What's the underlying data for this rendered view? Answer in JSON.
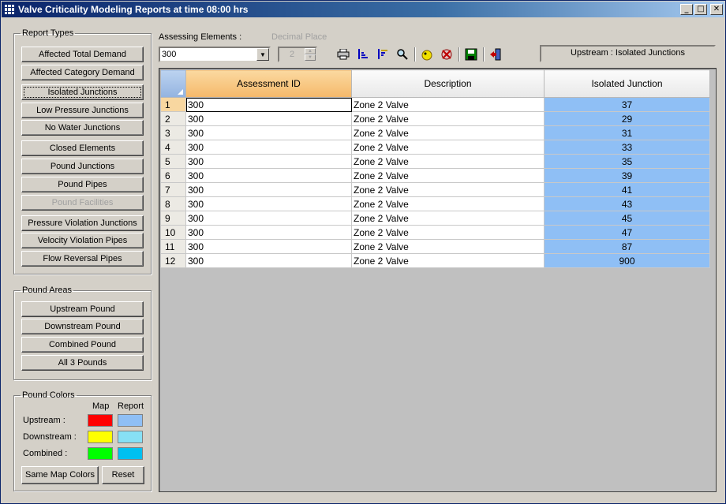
{
  "window": {
    "title": "Valve Criticality Modeling Reports at time 08:00 hrs",
    "controls": {
      "minimize": "_",
      "maximize": "□",
      "close": "✕"
    }
  },
  "report_types": {
    "legend": "Report Types",
    "buttons": [
      {
        "label": "Affected Total Demand",
        "enabled": true
      },
      {
        "label": "Affected Category Demand",
        "enabled": true
      },
      {
        "label": "Isolated Junctions",
        "enabled": true,
        "focused": true
      },
      {
        "label": "Low Pressure Junctions",
        "enabled": true
      },
      {
        "label": "No Water Junctions",
        "enabled": true
      },
      {
        "label": "Closed Elements",
        "enabled": true
      },
      {
        "label": "Pound Junctions",
        "enabled": true
      },
      {
        "label": "Pound Pipes",
        "enabled": true
      },
      {
        "label": "Pound Facilities",
        "enabled": false
      },
      {
        "label": "Pressure Violation Junctions",
        "enabled": true
      },
      {
        "label": "Velocity Violation Pipes",
        "enabled": true
      },
      {
        "label": "Flow Reversal Pipes",
        "enabled": true
      }
    ]
  },
  "pound_areas": {
    "legend": "Pound Areas",
    "buttons": [
      "Upstream Pound",
      "Downstream Pound",
      "Combined Pound",
      "All 3 Pounds"
    ]
  },
  "pound_colors": {
    "legend": "Pound Colors",
    "col_map": "Map",
    "col_report": "Report",
    "rows": [
      {
        "label": "Upstream :",
        "map": "#ff0000",
        "report": "#8fbff5"
      },
      {
        "label": "Downstream :",
        "map": "#ffff00",
        "report": "#87e0f5"
      },
      {
        "label": "Combined :",
        "map": "#00ff00",
        "report": "#00c0f0"
      }
    ],
    "same_map_colors": "Same Map Colors",
    "reset": "Reset"
  },
  "controls": {
    "assessing_label": "Assessing Elements :",
    "assessing_value": "300",
    "decimal_label": "Decimal Place",
    "decimal_value": "2",
    "status": "Upstream : Isolated Junctions",
    "toolbar_icons": [
      "print-icon",
      "sort-ascending-icon",
      "sort-descending-icon",
      "find-icon",
      "highlight-icon",
      "clear-highlight-icon",
      "save-icon",
      "exit-icon"
    ]
  },
  "grid": {
    "columns": [
      "Assessment ID",
      "Description",
      "Isolated Junction"
    ],
    "rows": [
      {
        "n": "1",
        "id": "300",
        "desc": "Zone 2  Valve",
        "junction": "37"
      },
      {
        "n": "2",
        "id": "300",
        "desc": "Zone 2  Valve",
        "junction": "29"
      },
      {
        "n": "3",
        "id": "300",
        "desc": "Zone 2  Valve",
        "junction": "31"
      },
      {
        "n": "4",
        "id": "300",
        "desc": "Zone 2  Valve",
        "junction": "33"
      },
      {
        "n": "5",
        "id": "300",
        "desc": "Zone 2  Valve",
        "junction": "35"
      },
      {
        "n": "6",
        "id": "300",
        "desc": "Zone 2  Valve",
        "junction": "39"
      },
      {
        "n": "7",
        "id": "300",
        "desc": "Zone 2  Valve",
        "junction": "41"
      },
      {
        "n": "8",
        "id": "300",
        "desc": "Zone 2  Valve",
        "junction": "43"
      },
      {
        "n": "9",
        "id": "300",
        "desc": "Zone 2  Valve",
        "junction": "45"
      },
      {
        "n": "10",
        "id": "300",
        "desc": "Zone 2  Valve",
        "junction": "47"
      },
      {
        "n": "11",
        "id": "300",
        "desc": "Zone 2  Valve",
        "junction": "87"
      },
      {
        "n": "12",
        "id": "300",
        "desc": "Zone 2  Valve",
        "junction": "900"
      }
    ]
  }
}
